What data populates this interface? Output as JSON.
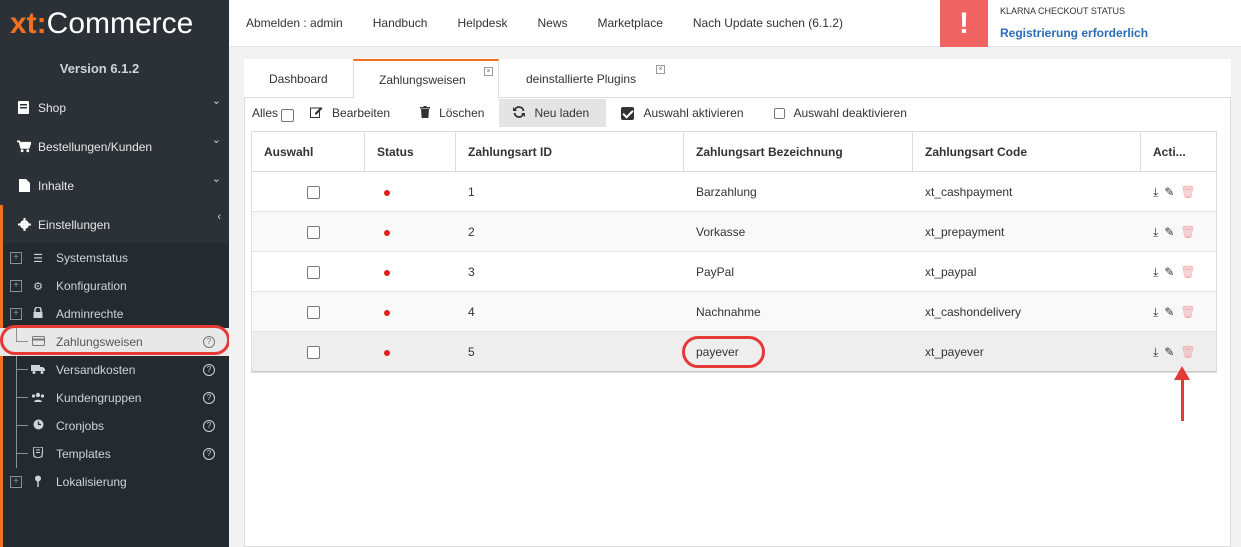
{
  "brand": {
    "xt": "xt:",
    "rest": "Commerce"
  },
  "version": "Version 6.1.2",
  "topnav": [
    "Abmelden : admin",
    "Handbuch",
    "Helpdesk",
    "News",
    "Marketplace",
    "Nach Update suchen (6.1.2)"
  ],
  "klarna": {
    "alert": "!",
    "title": "KLARNA CHECKOUT STATUS",
    "link": "Registrierung erforderlich"
  },
  "sidebar": {
    "main": [
      {
        "label": "Shop",
        "icon": "book-icon"
      },
      {
        "label": "Bestellungen/Kunden",
        "icon": "cart-icon"
      },
      {
        "label": "Inhalte",
        "icon": "file-icon"
      },
      {
        "label": "Einstellungen",
        "icon": "gear-icon"
      }
    ],
    "sub": [
      {
        "label": "Systemstatus",
        "icon": "list-icon"
      },
      {
        "label": "Konfiguration",
        "icon": "gear-icon"
      },
      {
        "label": "Adminrechte",
        "icon": "lock-icon"
      },
      {
        "label": "Zahlungsweisen",
        "icon": "card-icon"
      },
      {
        "label": "Versandkosten",
        "icon": "truck-icon"
      },
      {
        "label": "Kundengruppen",
        "icon": "users-icon"
      },
      {
        "label": "Cronjobs",
        "icon": "clock-icon"
      },
      {
        "label": "Templates",
        "icon": "html5-icon"
      },
      {
        "label": "Lokalisierung",
        "icon": "pin-icon"
      }
    ]
  },
  "tabs": [
    "Dashboard",
    "Zahlungsweisen",
    "deinstallierte Plugins"
  ],
  "toolbar": {
    "alles": "Alles",
    "edit": "Bearbeiten",
    "delete": "Löschen",
    "reload": "Neu laden",
    "activate": "Auswahl aktivieren",
    "deactivate": "Auswahl deaktivieren"
  },
  "grid": {
    "headers": [
      "Auswahl",
      "Status",
      "Zahlungsart ID",
      "Zahlungsart Bezeichnung",
      "Zahlungsart Code",
      "Acti..."
    ],
    "rows": [
      {
        "id": "1",
        "name": "Barzahlung",
        "code": "xt_cashpayment"
      },
      {
        "id": "2",
        "name": "Vorkasse",
        "code": "xt_prepayment"
      },
      {
        "id": "3",
        "name": "PayPal",
        "code": "xt_paypal"
      },
      {
        "id": "4",
        "name": "Nachnahme",
        "code": "xt_cashondelivery"
      },
      {
        "id": "5",
        "name": "payever",
        "code": "xt_payever"
      }
    ]
  },
  "colors": {
    "accent": "#f37021",
    "sidebar": "#2b3137",
    "alert": "#f06363",
    "link": "#2a6db5",
    "annotation": "#e53935"
  }
}
